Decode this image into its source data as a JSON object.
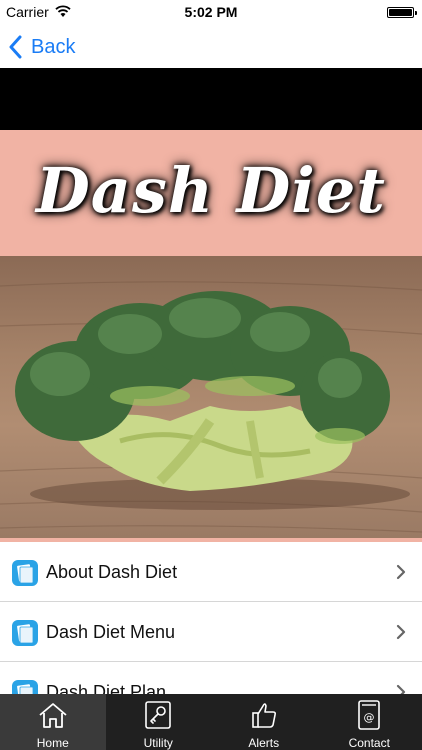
{
  "status_bar": {
    "carrier": "Carrier",
    "time": "5:02 PM"
  },
  "nav": {
    "back_label": "Back"
  },
  "banner": {
    "title": "Dash Diet",
    "background": "#f1b3a4"
  },
  "menu": {
    "items": [
      {
        "label": "About Dash Diet"
      },
      {
        "label": "Dash Diet Menu"
      },
      {
        "label": "Dash Diet Plan"
      }
    ]
  },
  "tab_bar": {
    "tabs": [
      {
        "label": "Home",
        "icon": "home-icon",
        "active": true
      },
      {
        "label": "Utility",
        "icon": "key-icon",
        "active": false
      },
      {
        "label": "Alerts",
        "icon": "thumbs-up-icon",
        "active": false
      },
      {
        "label": "Contact",
        "icon": "contact-book-icon",
        "active": false
      }
    ]
  },
  "colors": {
    "accent": "#1a7cf5",
    "tab_bar_bg": "#202020",
    "icon_blue": "#2aa3e6"
  }
}
